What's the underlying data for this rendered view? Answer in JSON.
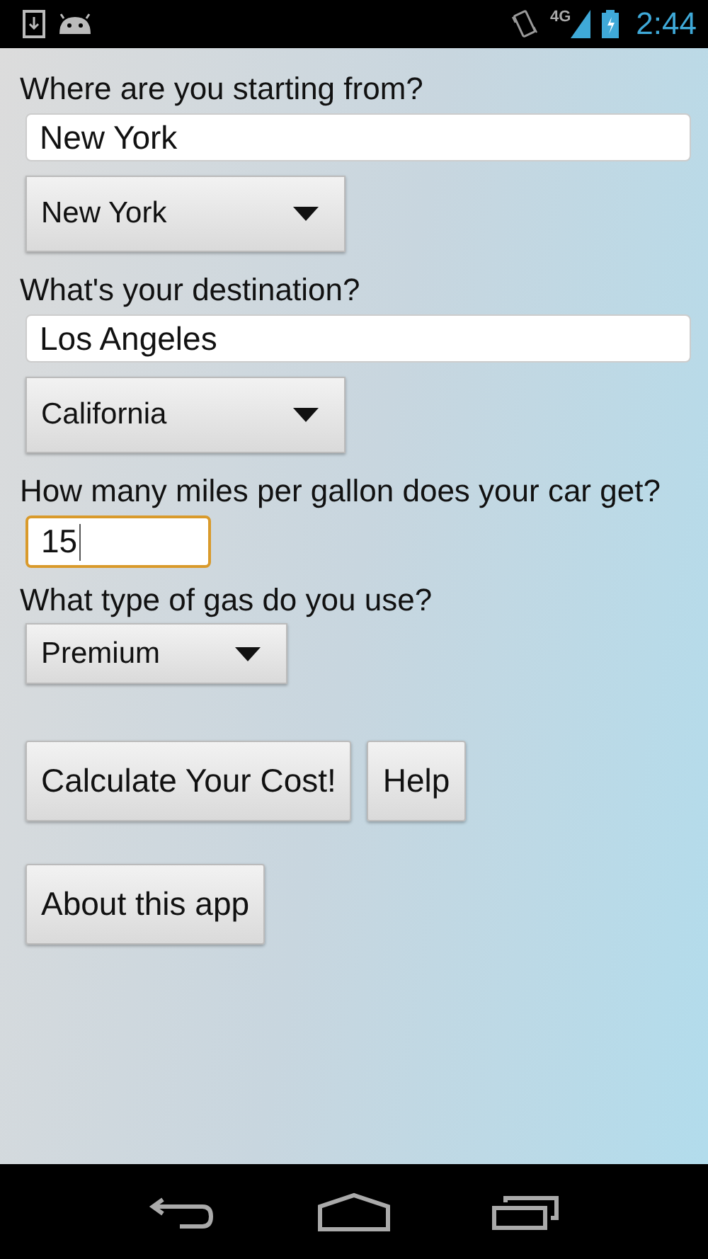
{
  "status_bar": {
    "time": "2:44",
    "network": "4G"
  },
  "form": [
    {
      "kind": "label",
      "text": "Where are you starting from?"
    },
    {
      "kind": "text_field",
      "value": "New York",
      "focused": false
    },
    {
      "kind": "spinner",
      "value": "New York"
    },
    {
      "kind": "label",
      "text": "What's your destination?"
    },
    {
      "kind": "text_field",
      "value": "Los Angeles",
      "focused": false
    },
    {
      "kind": "spinner",
      "value": "California"
    },
    {
      "kind": "label",
      "text": "How many miles per gallon does your car get?"
    },
    {
      "kind": "number_field",
      "value": "15",
      "focused": true
    },
    {
      "kind": "label",
      "text": "What type of gas do you use?"
    },
    {
      "kind": "small_spinner",
      "value": "Premium"
    }
  ],
  "button_rows": [
    {
      "buttons": [
        {
          "label": "Calculate Your Cost!"
        },
        {
          "label": "Help"
        }
      ]
    },
    {
      "buttons": [
        {
          "label": "About this app"
        }
      ]
    }
  ]
}
